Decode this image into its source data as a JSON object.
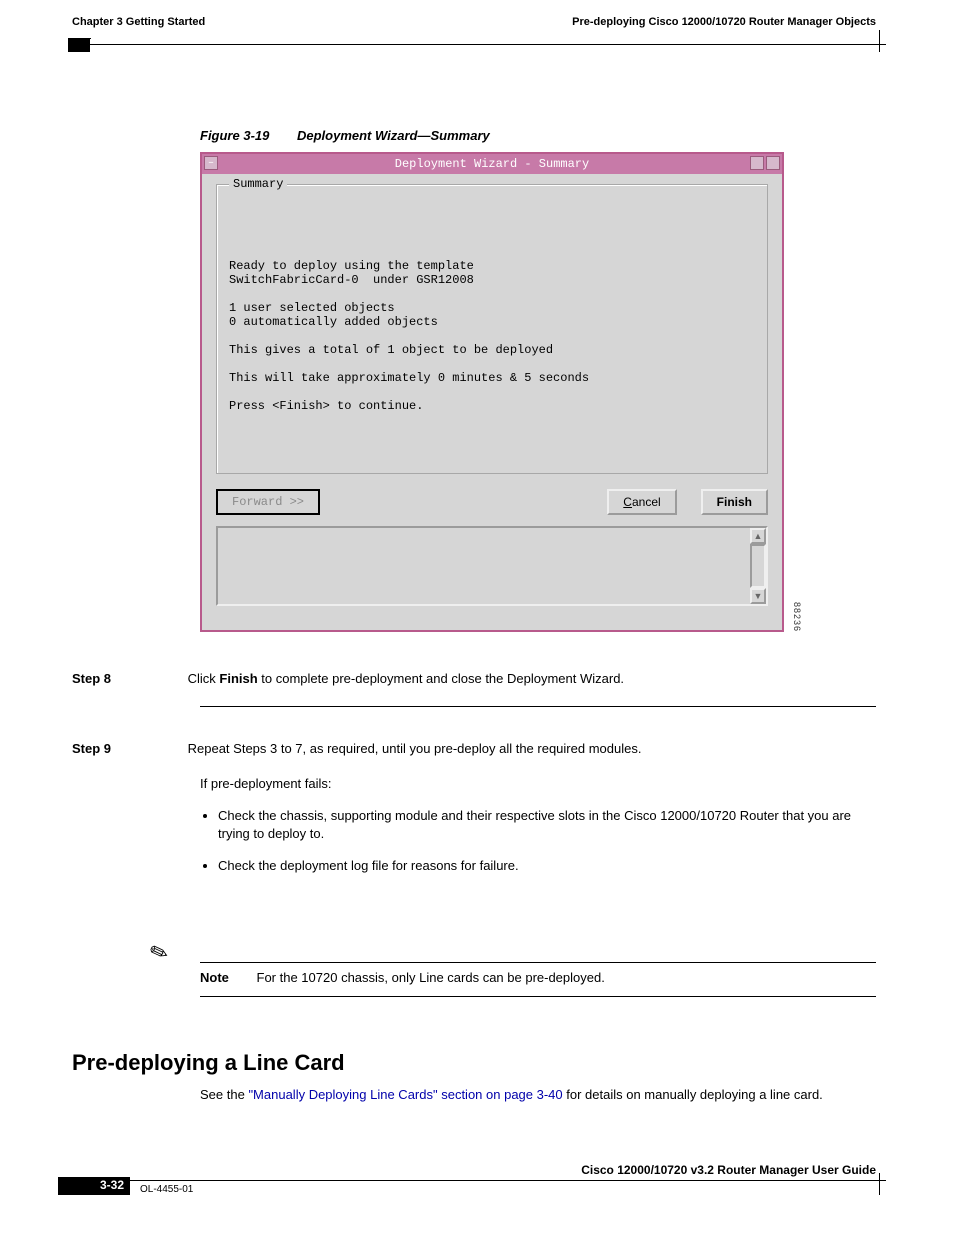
{
  "header": {
    "chapter_left": "Chapter 3      Getting Started",
    "chapter_right": "Pre-deploying Cisco 12000/10720 Router Manager Objects"
  },
  "figure": {
    "label": "Figure 3-19",
    "title": "Deployment Wizard—Summary",
    "side_number": "88236"
  },
  "dialog": {
    "title": "Deployment Wizard - Summary",
    "group_label": "Summary",
    "body": "Ready to deploy using the template\nSwitchFabricCard-0  under GSR12008\n\n1 user selected objects\n0 automatically added objects\n\nThis gives a total of 1 object to be deployed\n\nThis will take approximately 0 minutes & 5 seconds\n\nPress <Finish> to continue.",
    "buttons": {
      "forward": "Forward >>",
      "cancel": "Cancel",
      "finish": "Finish"
    }
  },
  "step8": {
    "num": "Step 8",
    "text_a": "Click ",
    "bold": "Finish",
    "text_b": " to complete pre-deployment and close the Deployment Wizard."
  },
  "step9": {
    "num": "Step 9",
    "text": "Repeat Steps 3 to 7, as required, until you pre-deploy all the required modules."
  },
  "afterfail": {
    "lead": "If pre-deployment fails:",
    "items": [
      "Check the chassis, supporting module and their respective slots in the Cisco 12000/10720 Router that you are trying to deploy to.",
      "Check the deployment log file for reasons for failure."
    ]
  },
  "note": {
    "label": "Note",
    "text": "For the 10720 chassis, only Line cards can be pre-deployed."
  },
  "section": {
    "heading": "Pre-deploying a Line Card",
    "body_a": "See the ",
    "link": "\"Manually Deploying Line Cards\" section on page 3-40",
    "body_b": " for details on manually deploying a line card."
  },
  "footer": {
    "title": "Cisco 12000/10720 v3.2 Router Manager User Guide",
    "page": "3-32",
    "doc": "OL-4455-01"
  }
}
